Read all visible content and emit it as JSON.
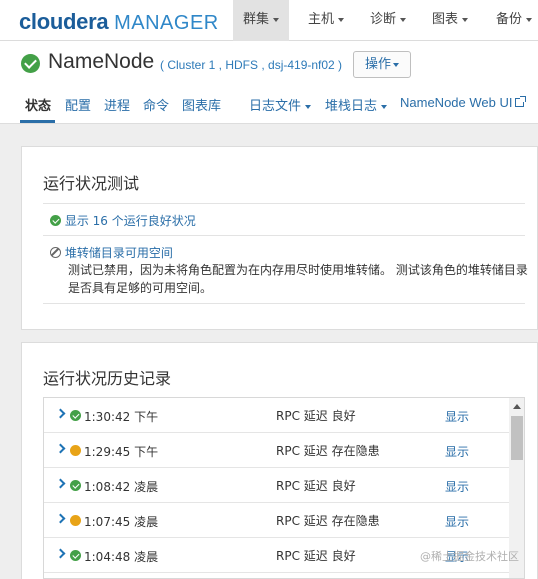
{
  "app": {
    "brand": "cloudera",
    "product": "MANAGER"
  },
  "topnav": {
    "items": [
      {
        "label": "群集",
        "active": true
      },
      {
        "label": "主机"
      },
      {
        "label": "诊断"
      },
      {
        "label": "图表"
      },
      {
        "label": "备份"
      }
    ]
  },
  "header": {
    "title": "NameNode",
    "subtitle": "( Cluster 1 , HDFS , dsj-419-nf02 )",
    "ops_label": "操作",
    "status_icon": "check-circle-icon",
    "status_color": "#43a047"
  },
  "tabs": [
    {
      "label": "状态",
      "active": true
    },
    {
      "label": "配置"
    },
    {
      "label": "进程"
    },
    {
      "label": "命令"
    },
    {
      "label": "图表库"
    },
    {
      "label": "日志文件"
    },
    {
      "label": "堆栈日志"
    },
    {
      "label": "NameNode Web UI"
    }
  ],
  "health_tests": {
    "title": "运行状况测试",
    "good_summary": "显示 16 个运行良好状况",
    "disabled_test": {
      "name": "堆转储目录可用空间",
      "description_line1": "测试已禁用，因为未将角色配置为在内存用尽时使用堆转储。 测试该角色的堆转储目录",
      "description_line2": "是否具有足够的可用空间。"
    }
  },
  "health_history": {
    "title": "运行状况历史记录",
    "show_label": "显示",
    "rows": [
      {
        "time": "1:30:42 下午",
        "status": "good",
        "message": "RPC 延迟 良好"
      },
      {
        "time": "1:29:45 下午",
        "status": "concerning",
        "message": "RPC 延迟 存在隐患"
      },
      {
        "time": "1:08:42 凌晨",
        "status": "good",
        "message": "RPC 延迟 良好"
      },
      {
        "time": "1:07:45 凌晨",
        "status": "concerning",
        "message": "RPC 延迟 存在隐患"
      },
      {
        "time": "1:04:48 凌晨",
        "status": "good",
        "message": "RPC 延迟 良好"
      }
    ]
  },
  "watermark": "@稀土掘金技术社区",
  "colors": {
    "accent": "#2a6ea8",
    "good": "#43a047",
    "concerning": "#e8a317"
  }
}
